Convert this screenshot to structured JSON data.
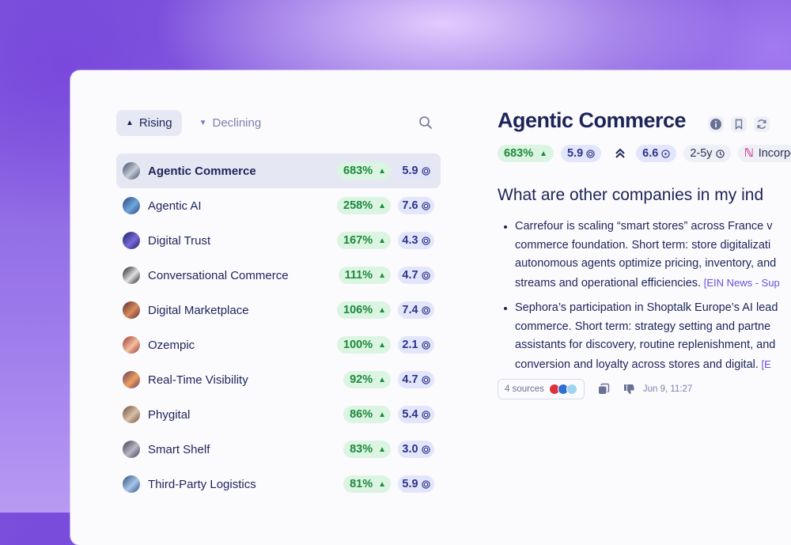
{
  "tabs": [
    {
      "label": "Rising",
      "active": true
    },
    {
      "label": "Declining",
      "active": false
    }
  ],
  "trends": [
    {
      "name": "Agentic Commerce",
      "growth": "683%",
      "score": "5.9",
      "selected": true,
      "avatar": [
        "#3b4a66",
        "#c4cbd8"
      ]
    },
    {
      "name": "Agentic AI",
      "growth": "258%",
      "score": "7.6",
      "avatar": [
        "#2a3e7a",
        "#6fa8dc"
      ]
    },
    {
      "name": "Digital Trust",
      "growth": "167%",
      "score": "4.3",
      "avatar": [
        "#16205a",
        "#7a6ad8"
      ]
    },
    {
      "name": "Conversational Commerce",
      "growth": "111%",
      "score": "4.7",
      "avatar": [
        "#1a1a1a",
        "#e0e0e0"
      ]
    },
    {
      "name": "Digital Marketplace",
      "growth": "106%",
      "score": "7.4",
      "avatar": [
        "#5a2a2a",
        "#d98c5f"
      ]
    },
    {
      "name": "Ozempic",
      "growth": "100%",
      "score": "2.1",
      "avatar": [
        "#a03030",
        "#f0c0a0"
      ]
    },
    {
      "name": "Real-Time Visibility",
      "growth": "92%",
      "score": "4.7",
      "avatar": [
        "#5a3a5a",
        "#f0a060"
      ]
    },
    {
      "name": "Phygital",
      "growth": "86%",
      "score": "5.4",
      "avatar": [
        "#6a4a3a",
        "#d8c0a8"
      ]
    },
    {
      "name": "Smart Shelf",
      "growth": "83%",
      "score": "3.0",
      "avatar": [
        "#3a3a4a",
        "#b8b8c8"
      ]
    },
    {
      "name": "Third-Party Logistics",
      "growth": "81%",
      "score": "5.9",
      "avatar": [
        "#2a4a7a",
        "#a8c8e8"
      ]
    }
  ],
  "detail": {
    "title": "Agentic Commerce",
    "growth": "683%",
    "score": "5.9",
    "speed": "6.6",
    "horizon": "2-5y",
    "stage": "Incorpora",
    "question": "What are other companies in my ind",
    "bullets": [
      {
        "lines": [
          "Carrefour is scaling “smart stores” across France v",
          "commerce foundation. Short term: store digitalizati",
          "autonomous agents optimize pricing, inventory, and",
          "streams and operational efficiencies."
        ],
        "cite": "[EIN News - Sup"
      },
      {
        "lines": [
          "Sephora’s participation in Shoptalk Europe’s AI lead",
          "commerce. Short term: strategy setting and partne",
          "assistants for discovery, routine replenishment, and",
          "conversion and loyalty across stores and digital."
        ],
        "cite": "[E"
      }
    ],
    "sources_label": "4 sources",
    "date": "Jun 9, 11:27"
  },
  "colors": {
    "navy": "#1d2457",
    "green_text": "#1c8a3c",
    "green_bg": "#dcf4e2",
    "blue_bg": "#e3e6fb",
    "accent": "#6b4fd8"
  }
}
